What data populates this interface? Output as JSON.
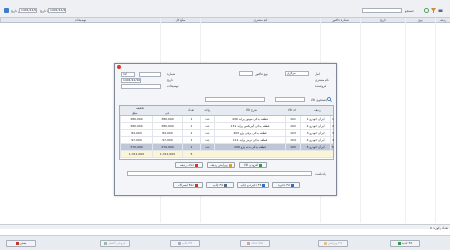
{
  "toolbar": {
    "date_from": "1401/12/01",
    "date_to": "1401/12/29",
    "from_label": "از تاریخ",
    "to_label": "تا تاریخ",
    "search_placeholder": "",
    "mode_label": "جستجو",
    "icons": [
      "refresh-icon",
      "filter-icon",
      "calendar-icon",
      "print-icon"
    ]
  },
  "grid": {
    "columns": [
      "توضیحات",
      "مبلغ کل",
      "نام مشتری",
      "شماره فاکتور",
      "تاریخ",
      "نوع",
      "ردیف"
    ]
  },
  "dialog": {
    "header_fields": {
      "store_label": "انبار",
      "store_value": "مرکزی",
      "customer_label": "نام مشتری",
      "customer_value": "",
      "type_label": "نوع فاکتور",
      "date_label": "تاریخ",
      "date_value": "1401/12/10",
      "number_label": "شماره",
      "number_value": "12",
      "desc_label": "توضیحات",
      "seller_label": "فروشنده"
    },
    "search_label": "جستجوی کالا",
    "items": {
      "headers": [
        "ردیف",
        "کد کالا",
        "شرح کالا",
        "واحد",
        "تعداد",
        "فی",
        "مبلغ",
        "تخفیف"
      ],
      "rows": [
        {
          "idx": "1",
          "code": "101",
          "name": "ایران خودرو 1",
          "desc": "قطعه یدکی موتور پراید 206",
          "unit": "عدد",
          "qty": "1",
          "price": "380,000",
          "amount": "380,000"
        },
        {
          "idx": "2",
          "code": "102",
          "name": "ایران خودرو 2",
          "desc": "قطعه یدکی گیربکس پراید 131",
          "unit": "عدد",
          "qty": "1",
          "price": "380,000",
          "amount": "380,000"
        },
        {
          "idx": "3",
          "code": "103",
          "name": "ایران خودرو 3",
          "desc": "قطعه یدکی برقی پژو 405",
          "unit": "عدد",
          "qty": "1",
          "price": "84,000",
          "amount": "84,000"
        },
        {
          "idx": "4",
          "code": "104",
          "name": "ایران خودرو 4",
          "desc": "قطعه یدکی ترمز پراید 111",
          "unit": "عدد",
          "qty": "1",
          "price": "97,000",
          "amount": "97,000"
        },
        {
          "idx": "5",
          "code": "105",
          "name": "ایران خودرو 5",
          "desc": "قطعه یدکی بدنه پژو 206",
          "unit": "عدد",
          "qty": "1",
          "price": "370,000",
          "amount": "370,000"
        }
      ],
      "total_qty": "5",
      "total_price": "1,311,000",
      "total_amount": "1,311,000"
    },
    "row_buttons": {
      "add": "افزودن کالا",
      "edit": "ویرایش ردیف",
      "remove": "حذف ردیف"
    },
    "notes_label": "یادداشت",
    "bottom_buttons": {
      "save": "ذخیره F2",
      "save_print": "ذخیره و چاپ F3",
      "print": "چاپ F4",
      "cancel": "انصراف Esc"
    }
  },
  "footer": {
    "status": "تعداد رکورد: 0",
    "buttons": [
      "جدید F2",
      "ویرایش F3",
      "حذف Del",
      "چاپ F4",
      "خروجی اکسل",
      "بستن"
    ]
  },
  "colors": {
    "accent": "#2f6fc0",
    "close": "#e0352b",
    "selected_row": "#bfc7d6",
    "total_row": "#fbf5d8"
  }
}
